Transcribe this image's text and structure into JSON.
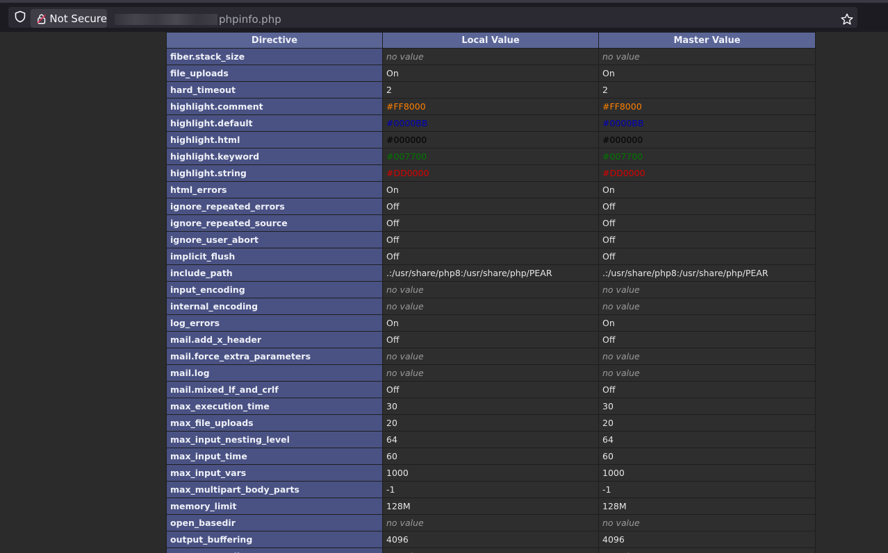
{
  "browser": {
    "security_label": "Not Secure",
    "url_visible": "phpinfo.php",
    "icons": [
      "shield-icon",
      "lock-icon",
      "star-icon"
    ]
  },
  "table": {
    "headers": [
      "Directive",
      "Local Value",
      "Master Value"
    ],
    "rows": [
      {
        "directive": "fiber.stack_size",
        "local": "no value",
        "master": "no value"
      },
      {
        "directive": "file_uploads",
        "local": "On",
        "master": "On"
      },
      {
        "directive": "hard_timeout",
        "local": "2",
        "master": "2"
      },
      {
        "directive": "highlight.comment",
        "local": "#FF8000",
        "master": "#FF8000",
        "color": "#FF8000"
      },
      {
        "directive": "highlight.default",
        "local": "#0000BB",
        "master": "#0000BB",
        "color": "#0000BB"
      },
      {
        "directive": "highlight.html",
        "local": "#000000",
        "master": "#000000",
        "color": "#000000"
      },
      {
        "directive": "highlight.keyword",
        "local": "#007700",
        "master": "#007700",
        "color": "#007700"
      },
      {
        "directive": "highlight.string",
        "local": "#DD0000",
        "master": "#DD0000",
        "color": "#DD0000"
      },
      {
        "directive": "html_errors",
        "local": "On",
        "master": "On"
      },
      {
        "directive": "ignore_repeated_errors",
        "local": "Off",
        "master": "Off"
      },
      {
        "directive": "ignore_repeated_source",
        "local": "Off",
        "master": "Off"
      },
      {
        "directive": "ignore_user_abort",
        "local": "Off",
        "master": "Off"
      },
      {
        "directive": "implicit_flush",
        "local": "Off",
        "master": "Off"
      },
      {
        "directive": "include_path",
        "local": ".:/usr/share/php8:/usr/share/php/PEAR",
        "master": ".:/usr/share/php8:/usr/share/php/PEAR"
      },
      {
        "directive": "input_encoding",
        "local": "no value",
        "master": "no value"
      },
      {
        "directive": "internal_encoding",
        "local": "no value",
        "master": "no value"
      },
      {
        "directive": "log_errors",
        "local": "On",
        "master": "On"
      },
      {
        "directive": "mail.add_x_header",
        "local": "Off",
        "master": "Off"
      },
      {
        "directive": "mail.force_extra_parameters",
        "local": "no value",
        "master": "no value"
      },
      {
        "directive": "mail.log",
        "local": "no value",
        "master": "no value"
      },
      {
        "directive": "mail.mixed_lf_and_crlf",
        "local": "Off",
        "master": "Off"
      },
      {
        "directive": "max_execution_time",
        "local": "30",
        "master": "30"
      },
      {
        "directive": "max_file_uploads",
        "local": "20",
        "master": "20"
      },
      {
        "directive": "max_input_nesting_level",
        "local": "64",
        "master": "64"
      },
      {
        "directive": "max_input_time",
        "local": "60",
        "master": "60"
      },
      {
        "directive": "max_input_vars",
        "local": "1000",
        "master": "1000"
      },
      {
        "directive": "max_multipart_body_parts",
        "local": "-1",
        "master": "-1"
      },
      {
        "directive": "memory_limit",
        "local": "128M",
        "master": "128M"
      },
      {
        "directive": "open_basedir",
        "local": "no value",
        "master": "no value"
      },
      {
        "directive": "output_buffering",
        "local": "4096",
        "master": "4096"
      },
      {
        "directive": "output_encoding",
        "local": "no value",
        "master": "no value"
      }
    ]
  }
}
